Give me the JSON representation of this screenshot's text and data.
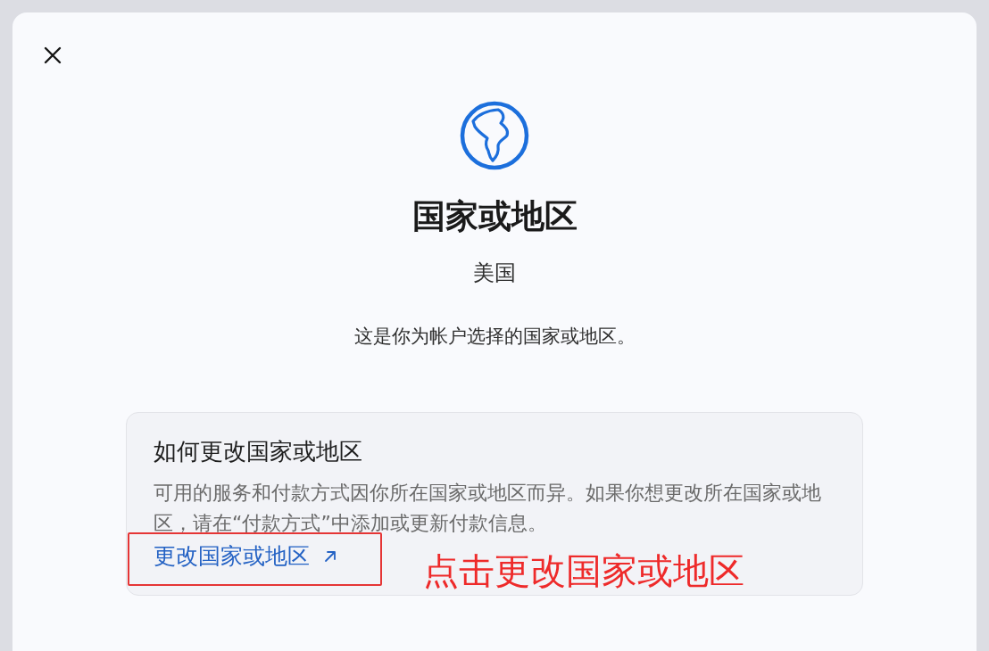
{
  "dialog": {
    "title": "国家或地区",
    "value": "美国",
    "description": "这是你为帐户选择的国家或地区。",
    "info_card": {
      "title": "如何更改国家或地区",
      "body": "可用的服务和付款方式因你所在国家或地区而异。如果你想更改所在国家或地区，请在“付款方式”中添加或更新付款信息。",
      "link": "更改国家或地区"
    }
  },
  "annotation": {
    "text": "点击更改国家或地区"
  }
}
